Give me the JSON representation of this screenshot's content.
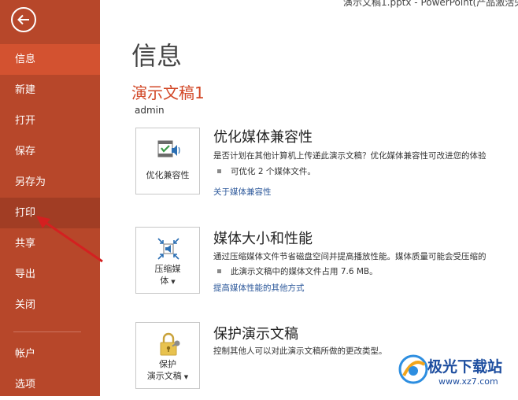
{
  "window": {
    "title": "演示文稿1.pptx - PowerPoint(产品激活失"
  },
  "sidebar": {
    "items": [
      {
        "label": "信息"
      },
      {
        "label": "新建"
      },
      {
        "label": "打开"
      },
      {
        "label": "保存"
      },
      {
        "label": "另存为"
      },
      {
        "label": "打印"
      },
      {
        "label": "共享"
      },
      {
        "label": "导出"
      },
      {
        "label": "关闭"
      },
      {
        "label": "帐户"
      },
      {
        "label": "选项"
      }
    ]
  },
  "main": {
    "title": "信息",
    "doc_title": "演示文稿1",
    "author": "admin",
    "sections": [
      {
        "button_label": "优化兼容性",
        "title": "优化媒体兼容性",
        "desc": "是否计划在其他计算机上传递此演示文稿？优化媒体兼容性可改进您的体验",
        "bullet": "可优化 2 个媒体文件。",
        "link": "关于媒体兼容性"
      },
      {
        "button_label_1": "压缩媒",
        "button_label_2": "体",
        "title": "媒体大小和性能",
        "desc": "通过压缩媒体文件节省磁盘空间并提高播放性能。媒体质量可能会受压缩的",
        "bullet": "此演示文稿中的媒体文件占用 7.6 MB。",
        "link": "提高媒体性能的其他方式"
      },
      {
        "button_label_1": "保护",
        "button_label_2": "演示文稿",
        "title": "保护演示文稿",
        "desc": "控制其他人可以对此演示文稿所做的更改类型。"
      }
    ]
  },
  "watermark": {
    "text": "极光下载站",
    "url": "www.xz7.com"
  },
  "colors": {
    "sidebar": "#b7472a",
    "active": "#d35230",
    "accent": "#d24726",
    "link": "#2b579a"
  }
}
